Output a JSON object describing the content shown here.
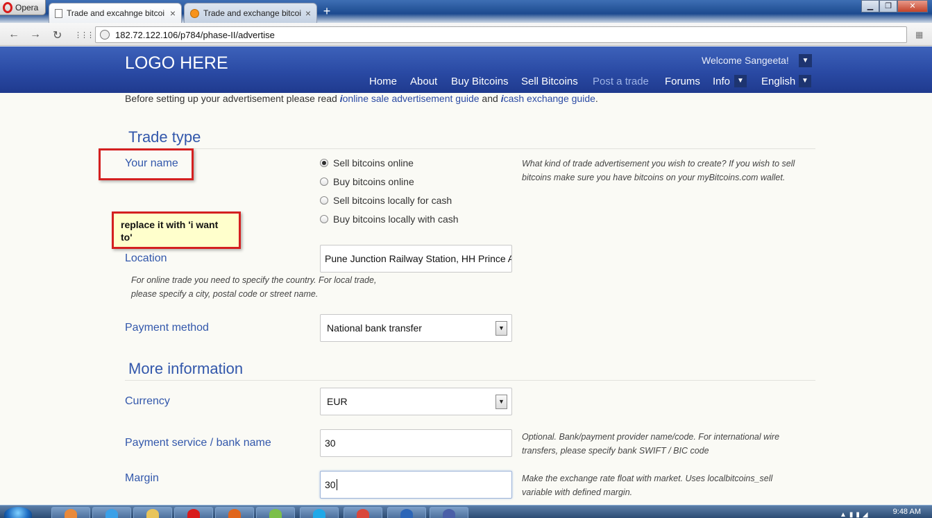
{
  "browser": {
    "app_label": "Opera",
    "tabs": [
      {
        "title": "Trade and excahnge bitcoi",
        "close": "×"
      },
      {
        "title": "Trade and exchange bitcoi",
        "close": "×"
      }
    ],
    "new_tab": "+",
    "window_controls": {
      "minimize": "▁",
      "maximize": "❐",
      "close": "✕"
    },
    "url": "182.72.122.106/p784/phase-II/advertise",
    "nav": {
      "back": "←",
      "forward": "→",
      "reload": "↻",
      "grid": "⋮⋮⋮"
    }
  },
  "site": {
    "logo": "LOGO HERE",
    "welcome": "Welcome Sangeeta!",
    "nav": [
      {
        "label": "Home"
      },
      {
        "label": "About"
      },
      {
        "label": "Buy Bitcoins"
      },
      {
        "label": "Sell Bitcoins"
      },
      {
        "label": "Post a trade"
      },
      {
        "label": "Forums"
      },
      {
        "label": "Info"
      },
      {
        "label": "English"
      }
    ],
    "caret": "⌄"
  },
  "intro": {
    "before": "Before setting up your advertisement please read ",
    "link1": "online sale advertisement guide",
    "and": " and ",
    "link2": "cash exchange guide",
    "end": ".",
    "info_icon": "i"
  },
  "sections": {
    "trade_type": "Trade type",
    "more_info": "More information"
  },
  "form": {
    "your_name_label": "Your name",
    "trade_options": [
      {
        "label": "Sell bitcoins online",
        "selected": true
      },
      {
        "label": "Buy bitcoins online",
        "selected": false
      },
      {
        "label": "Sell bitcoins locally for cash",
        "selected": false
      },
      {
        "label": "Buy bitcoins locally with cash",
        "selected": false
      }
    ],
    "trade_help": "What kind of trade advertisement you wish to create? If you wish to sell bitcoins make sure you have bitcoins on your myBitcoins.com wallet.",
    "location_label": "Location",
    "location_value": "Pune Junction Railway Station, HH Prince A",
    "location_help": "For online trade you need to specify the country. For local trade, please specify a city, postal code or street name.",
    "payment_method_label": "Payment method",
    "payment_method_value": "National bank transfer",
    "currency_label": "Currency",
    "currency_value": "EUR",
    "bank_label": "Payment service / bank name",
    "bank_value": "30",
    "bank_help": "Optional. Bank/payment provider name/code. For international wire transfers, please specify bank SWIFT / BIC code",
    "margin_label": "Margin",
    "margin_value": "30",
    "margin_help": "Make the exchange rate float with market. Uses localbitcoins_sell variable with defined margin.",
    "select_arrow": "▼"
  },
  "annotation": {
    "note": "replace it with 'i want to'"
  },
  "taskbar": {
    "clock": "9:48 AM",
    "apps": [
      "media-player",
      "internet-explorer",
      "file-explorer",
      "opera",
      "firefox",
      "maps",
      "skype",
      "chrome",
      "thunderbird",
      "photo-viewer"
    ],
    "colors": {
      "accent": "#2a4aa4",
      "annotation": "#d42020",
      "note_bg": "#ffffcc"
    }
  }
}
